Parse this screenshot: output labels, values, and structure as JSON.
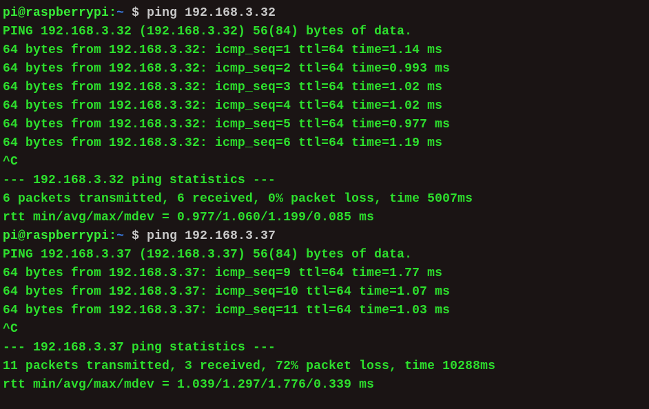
{
  "session1": {
    "user": "pi",
    "at": "@",
    "host": "raspberrypi",
    "colon": ":",
    "path": "~",
    "prompt": " $ ",
    "command": "ping 192.168.3.32",
    "header": "PING 192.168.3.32 (192.168.3.32) 56(84) bytes of data.",
    "replies": [
      "64 bytes from 192.168.3.32: icmp_seq=1 ttl=64 time=1.14 ms",
      "64 bytes from 192.168.3.32: icmp_seq=2 ttl=64 time=0.993 ms",
      "64 bytes from 192.168.3.32: icmp_seq=3 ttl=64 time=1.02 ms",
      "64 bytes from 192.168.3.32: icmp_seq=4 ttl=64 time=1.02 ms",
      "64 bytes from 192.168.3.32: icmp_seq=5 ttl=64 time=0.977 ms",
      "64 bytes from 192.168.3.32: icmp_seq=6 ttl=64 time=1.19 ms"
    ],
    "interrupt": "^C",
    "stats_header": "--- 192.168.3.32 ping statistics ---",
    "stats_summary": "6 packets transmitted, 6 received, 0% packet loss, time 5007ms",
    "stats_rtt": "rtt min/avg/max/mdev = 0.977/1.060/1.199/0.085 ms"
  },
  "session2": {
    "user": "pi",
    "at": "@",
    "host": "raspberrypi",
    "colon": ":",
    "path": "~",
    "prompt": " $ ",
    "command": "ping 192.168.3.37",
    "header": "PING 192.168.3.37 (192.168.3.37) 56(84) bytes of data.",
    "replies": [
      "64 bytes from 192.168.3.37: icmp_seq=9 ttl=64 time=1.77 ms",
      "64 bytes from 192.168.3.37: icmp_seq=10 ttl=64 time=1.07 ms",
      "64 bytes from 192.168.3.37: icmp_seq=11 ttl=64 time=1.03 ms"
    ],
    "interrupt": "^C",
    "stats_header": "--- 192.168.3.37 ping statistics ---",
    "stats_summary": "11 packets transmitted, 3 received, 72% packet loss, time 10288ms",
    "stats_rtt": "rtt min/avg/max/mdev = 1.039/1.297/1.776/0.339 ms"
  }
}
